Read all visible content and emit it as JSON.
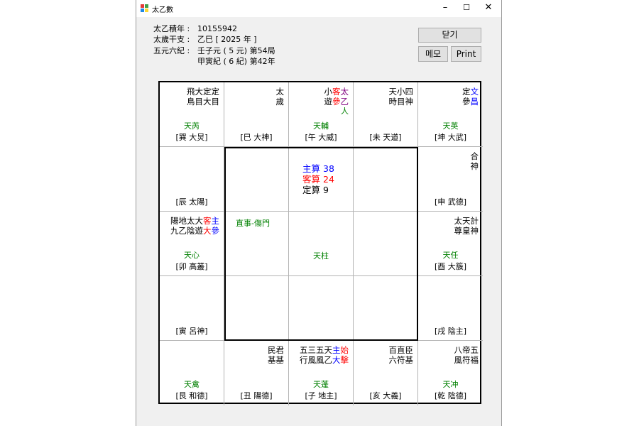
{
  "window": {
    "title": "太乙數",
    "minimize": "–",
    "maximize": "☐",
    "close": "✕",
    "icon_colors": [
      "#e53935",
      "#43a047",
      "#1e88e5",
      "#fdd835"
    ]
  },
  "info": {
    "rows": [
      {
        "label": "太乙積年 :",
        "value": "10155942"
      },
      {
        "label": "太歲干支 :",
        "value": "乙巳 [ 2025 年 ]"
      },
      {
        "label": "五元六紀 :",
        "value": "壬子元 ( 5 元) 第54局"
      },
      {
        "label": "",
        "value": "甲寅紀 ( 6 紀) 第42年"
      }
    ]
  },
  "buttons": {
    "close": "닫기",
    "memo": "메모",
    "print": "Print"
  },
  "grid": {
    "top": [
      {
        "line1": [
          [
            "飛大定定",
            "k"
          ]
        ],
        "line2": [
          [
            "鳥目大目",
            "k"
          ]
        ],
        "star": "天芮",
        "palace": "[巽 大炅]"
      },
      {
        "line1": [
          [
            "太",
            "k"
          ]
        ],
        "line2": [
          [
            "歲",
            "k"
          ]
        ],
        "star": "",
        "palace": "[巳 大神]"
      },
      {
        "line1": [
          [
            "小",
            "k"
          ],
          [
            "客",
            "r"
          ],
          [
            "太",
            "p"
          ]
        ],
        "line2": [
          [
            "遊",
            "k"
          ],
          [
            "參",
            "r"
          ],
          [
            "乙",
            "p"
          ]
        ],
        "line3": "人",
        "star": "天輔",
        "palace": "[午 大威]"
      },
      {
        "line1": [
          [
            "天小四",
            "k"
          ]
        ],
        "line2": [
          [
            "時目神",
            "k"
          ]
        ],
        "star": "",
        "palace": "[未 天道]"
      },
      {
        "line1": [
          [
            "定",
            "k"
          ],
          [
            "文",
            "b"
          ]
        ],
        "line2": [
          [
            "參",
            "k"
          ],
          [
            "昌",
            "b"
          ]
        ],
        "star": "天英",
        "palace": "[坤 大武]"
      }
    ],
    "row2": [
      {
        "line1": [],
        "line2": [],
        "star": "",
        "palace": "[辰 太陽]"
      },
      {
        "line1": [
          [
            "合",
            "k"
          ]
        ],
        "line2": [
          [
            "神",
            "k"
          ]
        ],
        "star": "",
        "palace": "[申 武德]"
      }
    ],
    "row3": [
      {
        "line1": [
          [
            "陽地太大",
            "k"
          ],
          [
            "客",
            "r"
          ],
          [
            "主",
            "b"
          ]
        ],
        "line2": [
          [
            "九乙陰遊",
            "k"
          ],
          [
            "大",
            "r"
          ],
          [
            "參",
            "b"
          ]
        ],
        "star": "天心",
        "palace": "[卯 高叢]"
      },
      {
        "line1": [
          [
            "太天計",
            "k"
          ]
        ],
        "line2": [
          [
            "尊皇神",
            "k"
          ]
        ],
        "star": "天任",
        "palace": "[酉 大簇]"
      }
    ],
    "row4": [
      {
        "line1": [],
        "line2": [],
        "star": "",
        "palace": "[寅 呂神]"
      },
      {
        "line1": [],
        "line2": [],
        "star": "",
        "palace": "[戌 陰主]"
      }
    ],
    "bottom": [
      {
        "line1": [],
        "line2": [],
        "star": "天禽",
        "palace": "[艮 和德]"
      },
      {
        "line1": [
          [
            "民君",
            "k"
          ]
        ],
        "line2": [
          [
            "基基",
            "k"
          ]
        ],
        "star": "",
        "palace": "[丑 陽德]"
      },
      {
        "line1": [
          [
            "五三五天",
            "k"
          ],
          [
            "主",
            "b"
          ],
          [
            "始",
            "r"
          ]
        ],
        "line2": [
          [
            "行風風乙",
            "k"
          ],
          [
            "大",
            "b"
          ],
          [
            "擊",
            "r"
          ]
        ],
        "star": "天蓬",
        "palace": "[子 地主]"
      },
      {
        "line1": [
          [
            "百直臣",
            "k"
          ]
        ],
        "line2": [
          [
            "六符基",
            "k"
          ]
        ],
        "star": "",
        "palace": "[亥 大義]"
      },
      {
        "line1": [
          [
            "八帝五",
            "k"
          ]
        ],
        "line2": [
          [
            "風符福",
            "k"
          ]
        ],
        "star": "天冲",
        "palace": "[乾 陰德]"
      }
    ],
    "calc": {
      "host_label": "主算",
      "host_value": "38",
      "guest_label": "客算",
      "guest_value": "24",
      "fixed_label": "定算",
      "fixed_value": "9"
    },
    "direct": "直事-傷門",
    "center_star": "天柱"
  }
}
